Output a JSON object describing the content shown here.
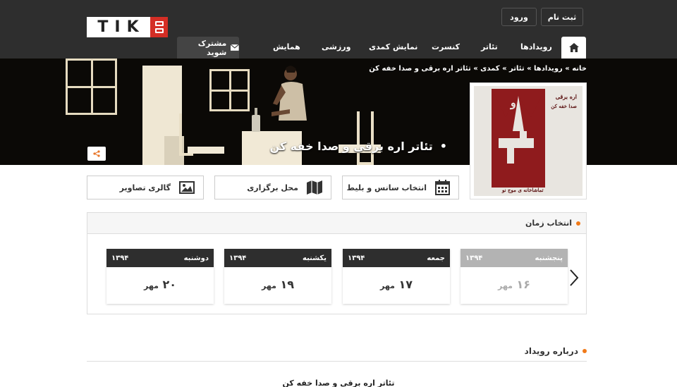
{
  "logo": {
    "text": "TIK"
  },
  "auth": {
    "register": "ثبت نام",
    "login": "ورود"
  },
  "nav": {
    "home_icon": "home-icon",
    "items": [
      "رویدادها",
      "تئاتر",
      "کنسرت",
      "نمایش کمدی",
      "ورزشی",
      "همایش"
    ],
    "subscribe": "مشترک شوید"
  },
  "hero": {
    "breadcrumb": "خانه » رویدادها » تئاتر » کمدی » تئاتر اره برقی و صدا خفه کن",
    "title": "تئاتر اره برقی و صدا خفه کن"
  },
  "poster": {
    "title_line1": "اره برقی",
    "title_line2": "و",
    "title_line3": "صدا خفه کن",
    "bottom": "تماشاخانه ی موج نو"
  },
  "actions": {
    "schedule": "انتخاب سانس و بلیط",
    "venue": "محل برگزاری",
    "gallery": "گالری تصاویر"
  },
  "time_panel": {
    "title": "انتخاب زمان",
    "days": [
      {
        "weekday": "پنجشنبه",
        "year": "۱۳۹۴",
        "day": "۱۶",
        "month": "مهر",
        "disabled": true
      },
      {
        "weekday": "جمعه",
        "year": "۱۳۹۴",
        "day": "۱۷",
        "month": "مهر",
        "disabled": false
      },
      {
        "weekday": "یکشنبه",
        "year": "۱۳۹۴",
        "day": "۱۹",
        "month": "مهر",
        "disabled": false
      },
      {
        "weekday": "دوشنبه",
        "year": "۱۳۹۴",
        "day": "۲۰",
        "month": "مهر",
        "disabled": false
      }
    ]
  },
  "about": {
    "heading": "درباره رویداد",
    "title": "تئاتر اره برقی و صدا خفه کن"
  },
  "colors": {
    "accent": "#f07a19",
    "logo_red": "#d42e25",
    "dark": "#2e2e2e"
  }
}
